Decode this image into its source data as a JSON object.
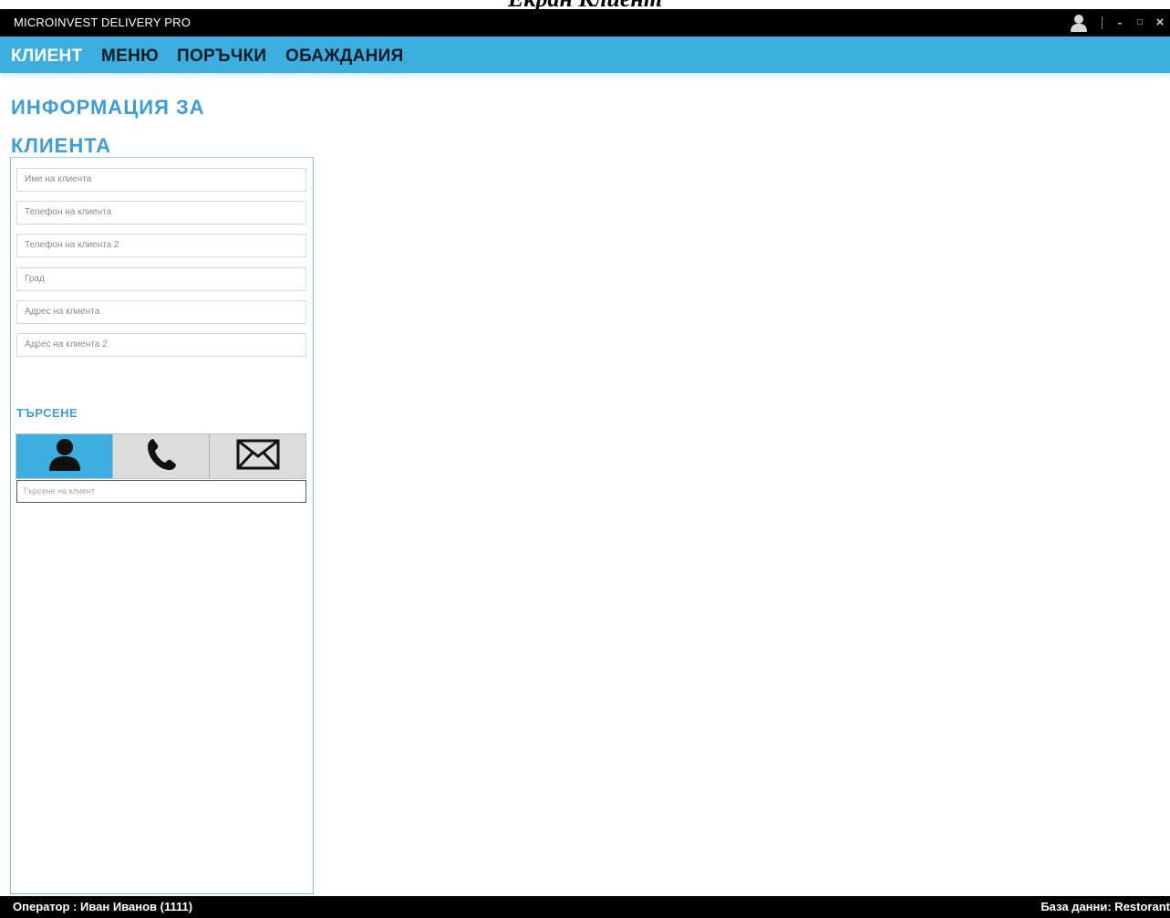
{
  "document": {
    "caption": "Екран Клиент"
  },
  "window": {
    "title": "MICROINVEST DELIVERY PRO",
    "controls": {
      "minimize": "-",
      "maximize": "□",
      "close": "×"
    }
  },
  "tabs": [
    {
      "label": "КЛИЕНТ"
    },
    {
      "label": "МЕНЮ"
    },
    {
      "label": "ПОРЪЧКИ"
    },
    {
      "label": "ОБАЖДАНИЯ"
    }
  ],
  "client_info": {
    "title_line1": "ИНФОРМАЦИЯ ЗА",
    "title_line2": "КЛИЕНТА",
    "fields": [
      {
        "placeholder": "Име на клиента",
        "value": ""
      },
      {
        "placeholder": "Телефон на клиента",
        "value": ""
      },
      {
        "placeholder": "Телефон на клиента 2",
        "value": ""
      },
      {
        "placeholder": "Град",
        "value": ""
      },
      {
        "placeholder": "Адрес на клиента",
        "value": ""
      },
      {
        "placeholder": "Адрес на клиента 2",
        "value": ""
      }
    ]
  },
  "search": {
    "label": "ТЪРСЕНЕ",
    "modes": [
      "user-icon",
      "phone-icon",
      "envelope-icon"
    ],
    "active_mode": "user-icon",
    "placeholder": "Търсене на клиент",
    "accent_color": "#3daee0"
  },
  "status": {
    "operator": "Оператор : Иван Иванов (1111)",
    "database": "База данни: Restorant"
  },
  "colors": {
    "accent": "#3daee0",
    "title_blue": "#3c9ed6",
    "titlebar": "#000000"
  }
}
